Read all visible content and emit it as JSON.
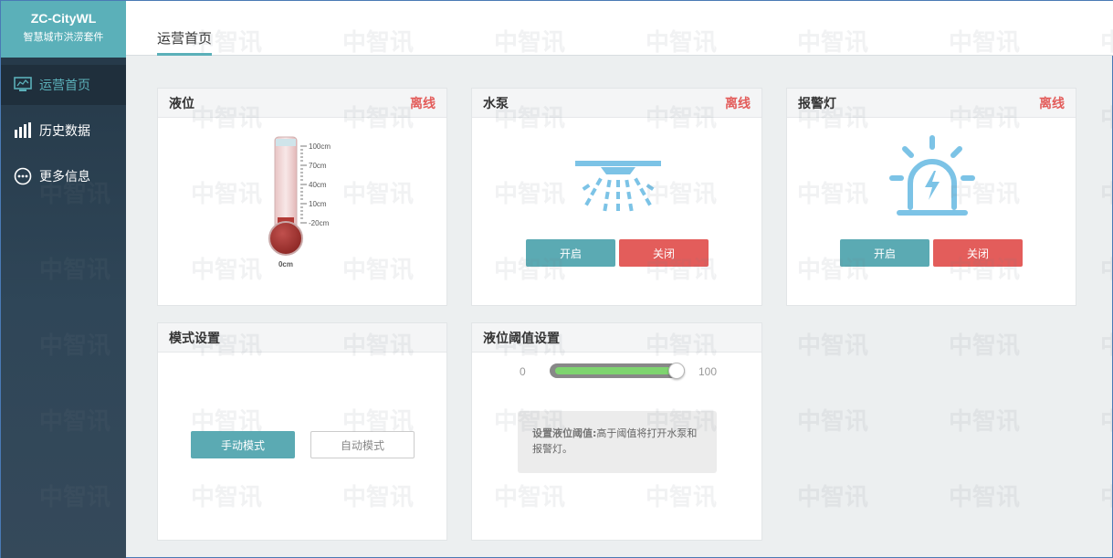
{
  "brand": {
    "title": "ZC-CityWL",
    "subtitle": "智慧城市洪涝套件"
  },
  "sidebar": {
    "items": [
      {
        "label": "运营首页",
        "icon": "monitor-icon",
        "active": true
      },
      {
        "label": "历史数据",
        "icon": "bar-chart-icon",
        "active": false
      },
      {
        "label": "更多信息",
        "icon": "more-circle-icon",
        "active": false
      }
    ]
  },
  "header": {
    "tab": "运营首页"
  },
  "cards": {
    "level": {
      "title": "液位",
      "status": "离线",
      "scale": [
        "100cm",
        "70cm",
        "40cm",
        "10cm",
        "-20cm"
      ],
      "reading": "0cm"
    },
    "pump": {
      "title": "水泵",
      "status": "离线",
      "on_label": "开启",
      "off_label": "关闭"
    },
    "alarm": {
      "title": "报警灯",
      "status": "离线",
      "on_label": "开启",
      "off_label": "关闭"
    },
    "mode": {
      "title": "模式设置",
      "manual_label": "手动模式",
      "auto_label": "自动模式"
    },
    "threshold": {
      "title": "液位阈值设置",
      "min_label": "0",
      "max_label": "100",
      "value_fraction": 1.0,
      "hint_title": "设置液位阈值:",
      "hint_text": "高于阈值将打开水泵和报警灯。"
    }
  },
  "watermark": "中智讯",
  "colors": {
    "accent": "#5bb0b9",
    "danger": "#e35d5b",
    "sidebar": "#2f4658"
  }
}
